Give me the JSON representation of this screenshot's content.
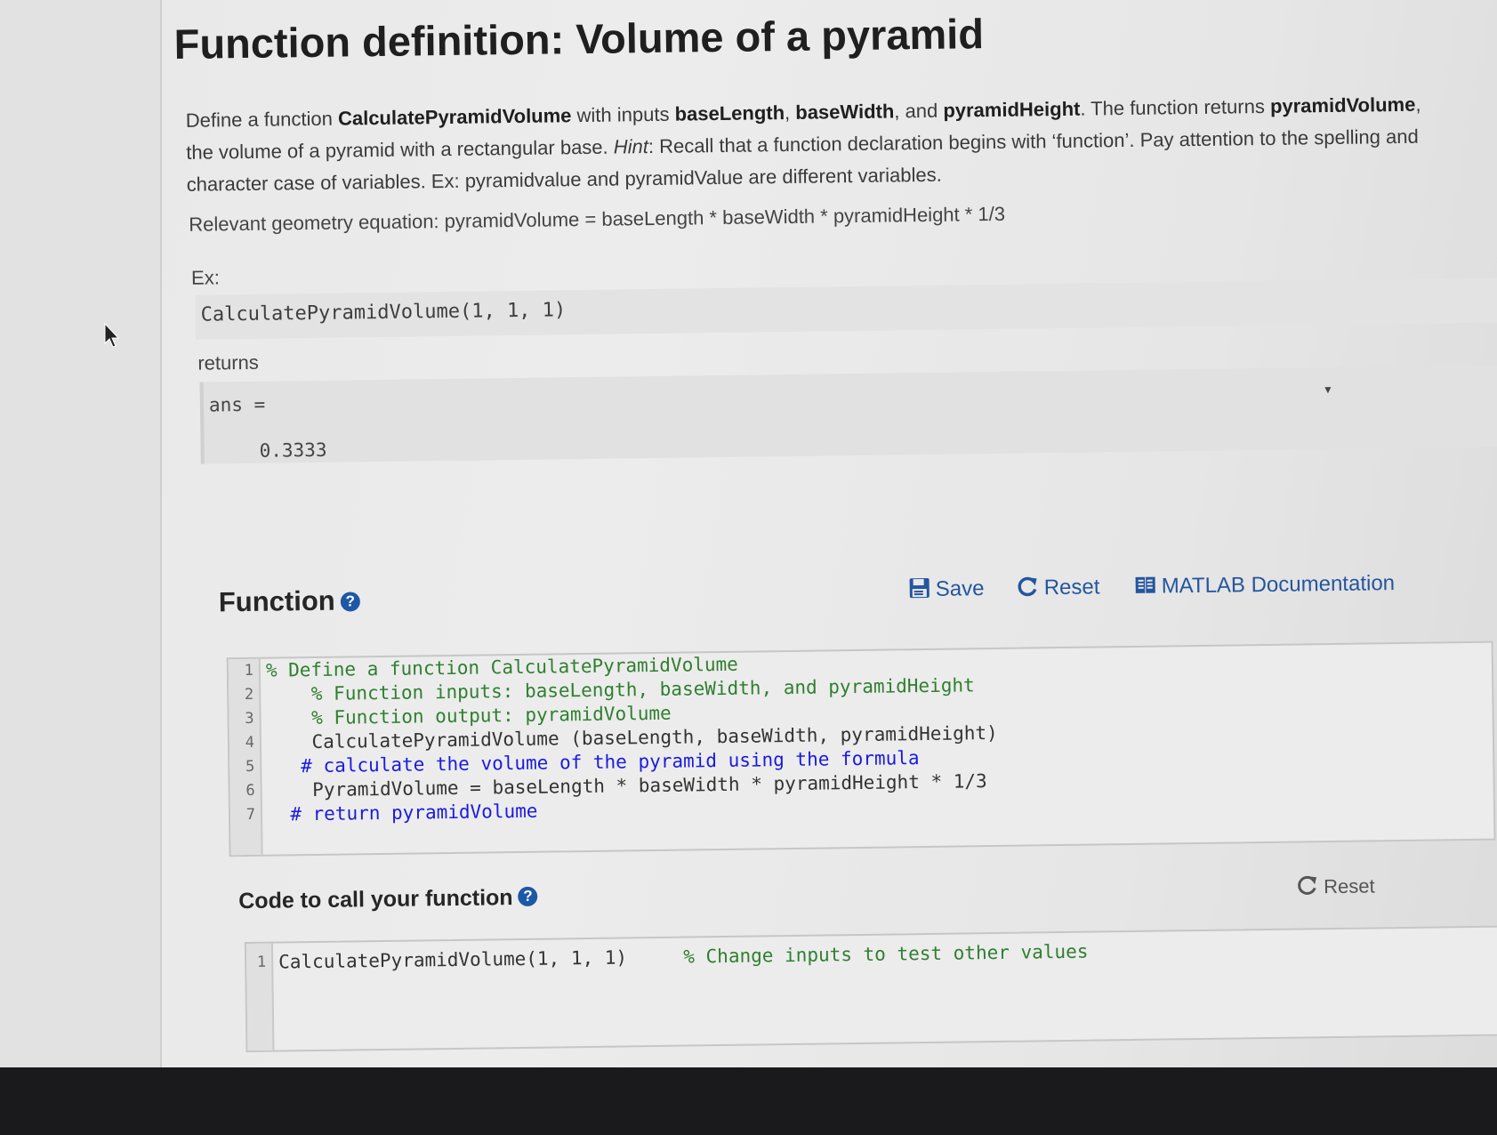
{
  "page": {
    "title": "Function definition: Volume of a pyramid"
  },
  "description": {
    "p1_a": "Define a function ",
    "p1_fn": "CalculatePyramidVolume",
    "p1_b": " with inputs ",
    "p1_in1": "baseLength",
    "p1_c": ", ",
    "p1_in2": "baseWidth",
    "p1_d": ", and ",
    "p1_in3": "pyramidHeight",
    "p1_e": ". The function returns ",
    "p1_out": "pyramidVolume",
    "p1_f": ", the volume of a pyramid with a rectangular base. ",
    "p1_hint": "Hint",
    "p1_g": ": Recall that a function declaration begins with ‘function’. Pay attention to the spelling and character case of variables. Ex: pyramidvalue and pyramidValue are different variables."
  },
  "equation": "Relevant geometry equation: pyramidVolume = baseLength * baseWidth * pyramidHeight * 1/3",
  "example": {
    "label": "Ex:",
    "call": "CalculatePyramidVolume(1, 1, 1)",
    "returns_label": "returns",
    "ans_label": "ans =",
    "ans_value": "0.3333"
  },
  "function_section": {
    "heading": "Function",
    "help_icon": "question-circle-icon",
    "save_label": "Save",
    "reset_label": "Reset",
    "doc_label": "MATLAB Documentation",
    "line_numbers": [
      "1",
      "2",
      "3",
      "4",
      "5",
      "6",
      "7"
    ],
    "code": [
      "% Define a function CalculatePyramidVolume",
      "    % Function inputs: baseLength, baseWidth, and pyramidHeight",
      "    % Function output: pyramidVolume",
      "    CalculatePyramidVolume (baseLength, baseWidth, pyramidHeight)",
      "   # calculate the volume of the pyramid using the formula",
      "    PyramidVolume = baseLength * baseWidth * pyramidHeight * 1/3",
      "  # return pyramidVolume"
    ]
  },
  "call_section": {
    "heading": "Code to call your function",
    "help_icon": "question-circle-icon",
    "reset_label": "Reset",
    "line_numbers": [
      "1"
    ],
    "code_call": "CalculatePyramidVolume(1, 1, 1)",
    "code_comment": "% Change inputs to test other values"
  },
  "colors": {
    "link_blue": "#24569e",
    "comment_green": "#2f7f2f",
    "keyword_blue": "#1a1ae0",
    "help_icon_blue": "#1d58a8"
  }
}
